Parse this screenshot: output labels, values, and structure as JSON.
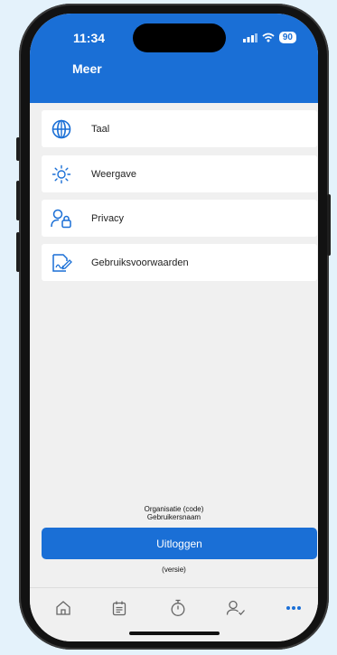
{
  "status_bar": {
    "time": "11:34",
    "battery": "90"
  },
  "header": {
    "title": "Meer"
  },
  "menu": [
    {
      "label": "Taal",
      "icon": "globe-icon"
    },
    {
      "label": "Weergave",
      "icon": "sun-icon"
    },
    {
      "label": "Privacy",
      "icon": "user-lock-icon"
    },
    {
      "label": "Gebruiksvoorwaarden",
      "icon": "document-signature-icon"
    }
  ],
  "footer": {
    "organization": "Organisatie (code)",
    "username": "Gebruikersnaam",
    "logout_label": "Uitloggen",
    "version": "(versie)"
  },
  "tabs": [
    {
      "icon": "home-icon"
    },
    {
      "icon": "calendar-icon"
    },
    {
      "icon": "stopwatch-icon"
    },
    {
      "icon": "user-check-icon"
    },
    {
      "icon": "more-icon",
      "active": true
    }
  ],
  "colors": {
    "primary": "#1a6fd6",
    "background": "#f0f0f0"
  }
}
